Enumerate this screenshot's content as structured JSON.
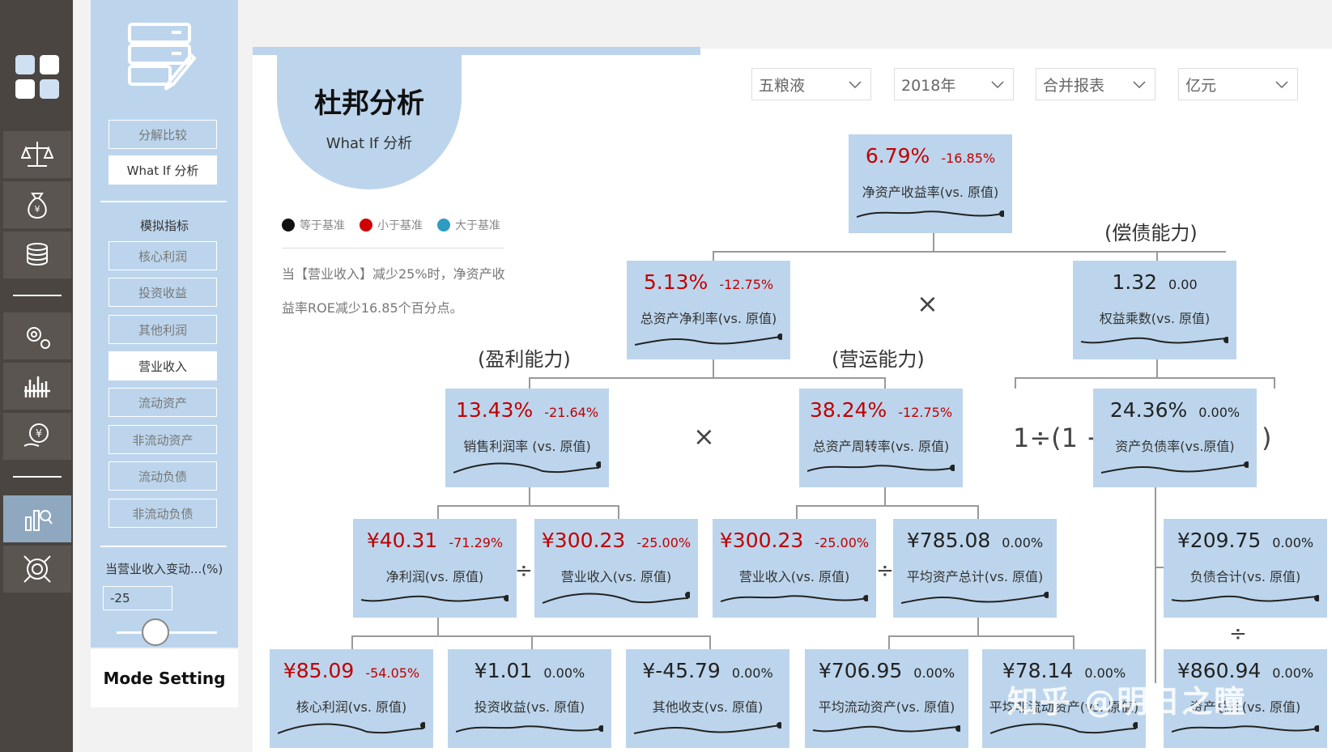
{
  "rail": {
    "items": [
      {
        "icon": "dashboard-grid-icon"
      },
      {
        "icon": "balance-scale-icon"
      },
      {
        "icon": "money-bag-icon"
      },
      {
        "icon": "coin-stack-icon"
      },
      {
        "icon": "gears-icon"
      },
      {
        "icon": "bar-chart-icon"
      },
      {
        "icon": "yen-hand-icon"
      },
      {
        "icon": "analysis-chart-icon"
      },
      {
        "icon": "target-icon"
      }
    ]
  },
  "sidebar": {
    "logo_icon": "form-edit-icon",
    "modes": [
      "分解比较",
      "What If 分析"
    ],
    "section_title": "模拟指标",
    "indicators": [
      "核心利润",
      "投资收益",
      "其他利润",
      "营业收入",
      "流动资产",
      "非流动资产",
      "流动负债",
      "非流动负债"
    ],
    "input_label": "当营业收入变动...(%)",
    "input_value": "-25",
    "mode_setting": "Mode Setting"
  },
  "header": {
    "title": "杜邦分析",
    "subtitle": "What If 分析",
    "filters": [
      "五粮液",
      "2018年",
      "合并报表",
      "亿元"
    ]
  },
  "legend": [
    {
      "label": "等于基准",
      "color": "#111111"
    },
    {
      "label": "小于基准",
      "color": "#d00000"
    },
    {
      "label": "大于基准",
      "color": "#2e9bc4"
    }
  ],
  "note": "当【营业收入】减少25%时，净资产收益率ROE减少16.85个百分点。",
  "groups": {
    "solvency": "(偿债能力)",
    "profitability": "(盈利能力)",
    "operation": "(营运能力)"
  },
  "operators": {
    "times": "×",
    "divide": "÷",
    "one_minus_open": "1÷(1 −",
    "close_paren": ")"
  },
  "boxes": {
    "roe": {
      "value": "6.79%",
      "change": "-16.85%",
      "label": "净资产收益率(vs. 原值)",
      "red": true
    },
    "roa": {
      "value": "5.13%",
      "change": "-12.75%",
      "label": "总资产净利率(vs. 原值)",
      "red": true
    },
    "em": {
      "value": "1.32",
      "change": "0.00",
      "label": "权益乘数(vs. 原值)",
      "red": false
    },
    "npm": {
      "value": "13.43%",
      "change": "-21.64%",
      "label": "销售利润率 (vs. 原值)",
      "red": true
    },
    "tat": {
      "value": "38.24%",
      "change": "-12.75%",
      "label": "总资产周转率(vs. 原值)",
      "red": true
    },
    "dar": {
      "value": "24.36%",
      "change": "0.00%",
      "label": "资产负债率(vs.原值)",
      "red": false
    },
    "ni": {
      "value": "¥40.31",
      "change": "-71.29%",
      "label": "净利润(vs. 原值)",
      "red": true
    },
    "rev1": {
      "value": "¥300.23",
      "change": "-25.00%",
      "label": "营业收入(vs. 原值)",
      "red": true
    },
    "rev2": {
      "value": "¥300.23",
      "change": "-25.00%",
      "label": "营业收入(vs. 原值)",
      "red": true
    },
    "avgta": {
      "value": "¥785.08",
      "change": "0.00%",
      "label": "平均资产总计(vs. 原值)",
      "red": false
    },
    "liab": {
      "value": "¥209.75",
      "change": "0.00%",
      "label": "负债合计(vs. 原值)",
      "red": false
    },
    "core": {
      "value": "¥85.09",
      "change": "-54.05%",
      "label": "核心利润(vs. 原值)",
      "red": true
    },
    "inv": {
      "value": "¥1.01",
      "change": "0.00%",
      "label": "投资收益(vs. 原值)",
      "red": false
    },
    "other": {
      "value": "¥-45.79",
      "change": "0.00%",
      "label": "其他收支(vs. 原值)",
      "red": false
    },
    "avgca": {
      "value": "¥706.95",
      "change": "0.00%",
      "label": "平均流动资产(vs. 原值)",
      "red": false
    },
    "avgnca": {
      "value": "¥78.14",
      "change": "0.00%",
      "label": "平均非流动资产(vs. 原值)",
      "red": false
    },
    "ta": {
      "value": "¥860.94",
      "change": "0.00%",
      "label": "资产总计(vs. 原值)",
      "red": false
    }
  },
  "watermark": "知乎 @明日之瞳"
}
